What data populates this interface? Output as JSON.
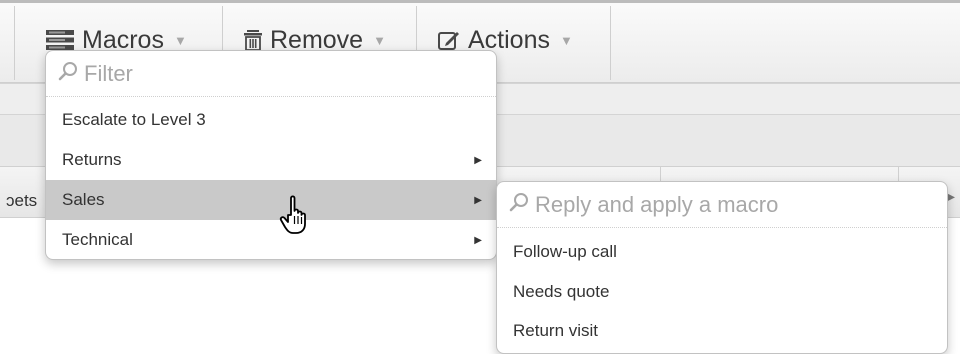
{
  "toolbar": {
    "macros_label": "Macros",
    "remove_label": "Remove",
    "actions_label": "Actions",
    "macros_icon": "macros-list-icon",
    "remove_icon": "trash-icon",
    "actions_icon": "edit-icon"
  },
  "background": {
    "strip_fragment": "ɔets"
  },
  "macros_menu": {
    "filter_placeholder": "Filter",
    "items": [
      {
        "label": "Escalate to Level 3",
        "has_submenu": false
      },
      {
        "label": "Returns",
        "has_submenu": true
      },
      {
        "label": "Sales",
        "has_submenu": true,
        "active": true
      },
      {
        "label": "Technical",
        "has_submenu": true
      }
    ]
  },
  "sales_menu": {
    "filter_placeholder": "Reply and apply a macro",
    "items": [
      {
        "label": "Follow-up call"
      },
      {
        "label": "Needs quote"
      },
      {
        "label": "Return visit"
      }
    ]
  },
  "colors": {
    "active_item_bg": "#c9c9c9",
    "placeholder_text": "#a8a8a8",
    "toolbar_text": "#3a3a3a"
  }
}
